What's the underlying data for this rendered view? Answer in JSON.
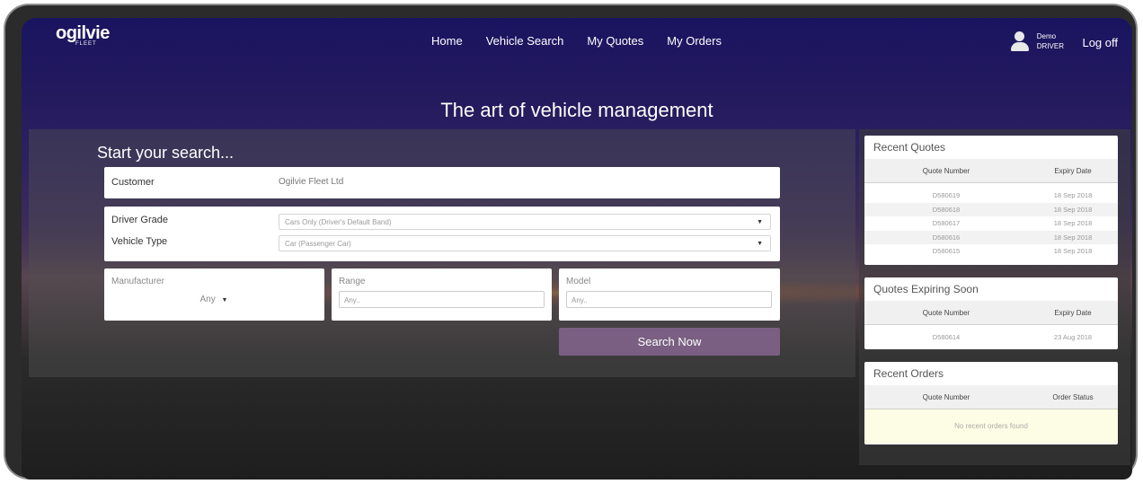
{
  "brand": {
    "name": "ogilvie",
    "sub": "FLEET"
  },
  "nav": [
    "Home",
    "Vehicle Search",
    "My Quotes",
    "My Orders"
  ],
  "user": {
    "name": "Demo",
    "role": "DRIVER",
    "logoff": "Log off"
  },
  "tagline": "The art of vehicle management",
  "search": {
    "heading": "Start your search...",
    "customer_label": "Customer",
    "customer_value": "Ogilvie Fleet Ltd",
    "driver_grade_label": "Driver Grade",
    "driver_grade_value": "Cars Only (Driver's Default Band)",
    "vehicle_type_label": "Vehicle Type",
    "vehicle_type_value": "Car (Passenger Car)",
    "manufacturer_label": "Manufacturer",
    "manufacturer_value": "Any",
    "range_label": "Range",
    "range_placeholder": "Any..",
    "model_label": "Model",
    "model_placeholder": "Any..",
    "button": "Search Now"
  },
  "recent_quotes": {
    "title": "Recent Quotes",
    "columns": [
      "Quote Number",
      "Expiry Date"
    ],
    "rows": [
      [
        "D580619",
        "18 Sep 2018"
      ],
      [
        "D580618",
        "18 Sep 2018"
      ],
      [
        "D580617",
        "18 Sep 2018"
      ],
      [
        "D580616",
        "18 Sep 2018"
      ],
      [
        "D580615",
        "18 Sep 2018"
      ]
    ]
  },
  "expiring": {
    "title": "Quotes Expiring Soon",
    "columns": [
      "Quote Number",
      "Expiry Date"
    ],
    "rows": [
      [
        "D580614",
        "23 Aug 2018"
      ]
    ]
  },
  "recent_orders": {
    "title": "Recent Orders",
    "columns": [
      "Quote Number",
      "Order Status"
    ],
    "empty": "No recent orders found"
  }
}
